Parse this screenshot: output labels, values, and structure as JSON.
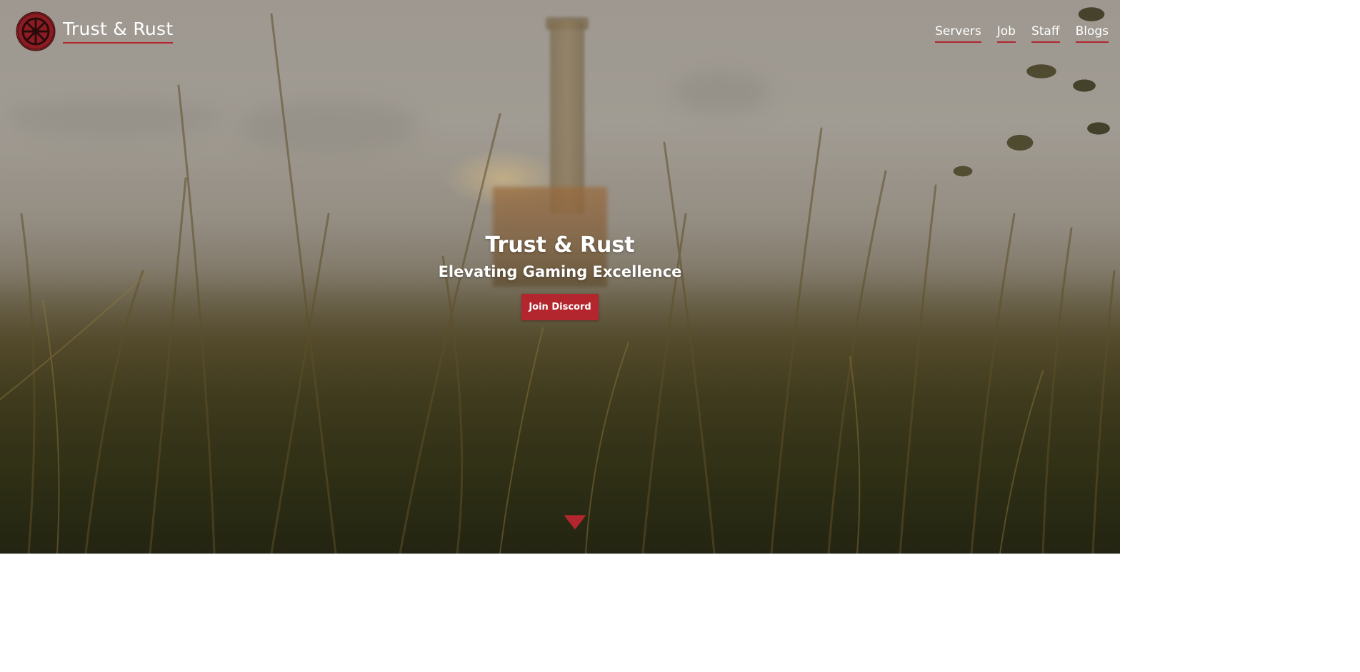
{
  "header": {
    "brand": "Trust & Rust",
    "logo_icon": "wheel-logo-icon",
    "nav": [
      {
        "label": "Servers"
      },
      {
        "label": "Job"
      },
      {
        "label": "Staff"
      },
      {
        "label": "Blogs"
      }
    ]
  },
  "hero": {
    "title": "Trust & Rust",
    "subtitle": "Elevating Gaming Excellence",
    "cta_label": "Join Discord",
    "scroll_icon": "triangle-down-icon"
  },
  "colors": {
    "accent": "#b3262e",
    "text": "#ffffff"
  }
}
